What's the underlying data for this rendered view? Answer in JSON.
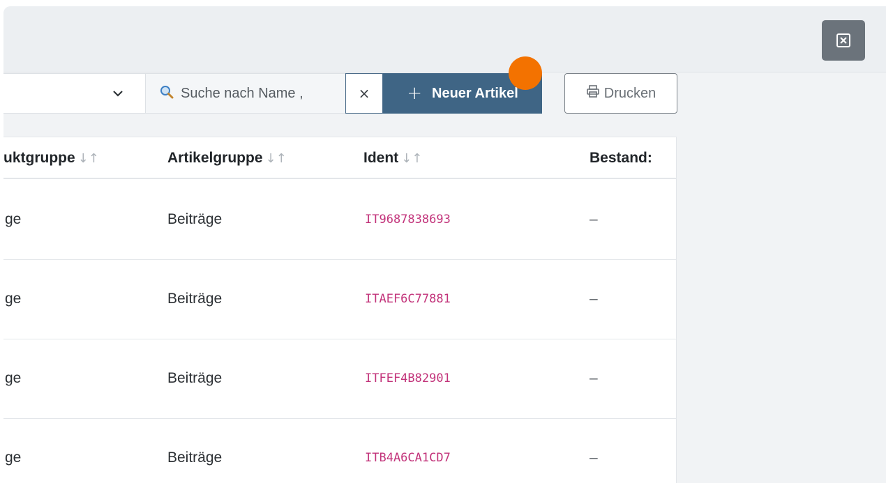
{
  "header": {
    "close_icon": "close-square-icon"
  },
  "toolbar": {
    "select_value": "",
    "search": {
      "placeholder": "Suche nach Name ,",
      "value": ""
    },
    "clear_label": "×",
    "new_button": {
      "plus": "+",
      "label": "Neuer Artikel"
    },
    "print_button": {
      "icon": "printer-icon",
      "label": "Drucken"
    }
  },
  "table": {
    "columns": [
      {
        "label": "uktgruppe",
        "sort": "↓↑"
      },
      {
        "label": "Artikelgruppe",
        "sort": "↓↑"
      },
      {
        "label": "Ident",
        "sort": "↓↑"
      },
      {
        "label": "Bestand:"
      }
    ],
    "rows": [
      {
        "produktgruppe": "ge",
        "artikelgruppe": "Beiträge",
        "ident": "IT9687838693",
        "bestand": "–"
      },
      {
        "produktgruppe": "ge",
        "artikelgruppe": "Beiträge",
        "ident": "ITAEF6C77881",
        "bestand": "–"
      },
      {
        "produktgruppe": "ge",
        "artikelgruppe": "Beiträge",
        "ident": "ITFEF4B82901",
        "bestand": "–"
      },
      {
        "produktgruppe": "ge",
        "artikelgruppe": "Beiträge",
        "ident": "ITB4A6CA1CD7",
        "bestand": "–"
      }
    ]
  },
  "colors": {
    "primary": "#3f6585",
    "ident": "#c2337a",
    "cursor": "#f37200"
  }
}
